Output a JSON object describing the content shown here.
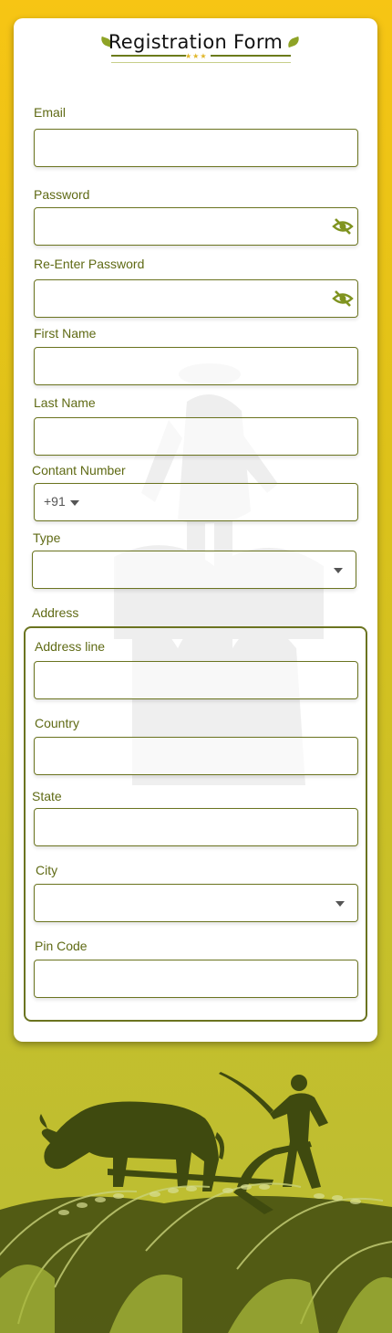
{
  "form": {
    "title": "Registration  Form",
    "email_label": "Email",
    "password_label": "Password",
    "reenter_password_label": "Re-Enter Password",
    "first_name_label": "First Name",
    "last_name_label": "Last Name",
    "contact_label": "Contant Number",
    "country_code": "+91",
    "type_label": "Type",
    "address_label": "Address",
    "address": {
      "address_line_label": "Address line",
      "country_label": "Country",
      "state_label": "State",
      "city_label": "City",
      "pin_label": "Pin Code"
    }
  },
  "colors": {
    "accent": "#6b7420",
    "label": "#5f6a14",
    "bg_top": "#f7c514",
    "bg_bottom": "#b9bd35"
  },
  "icons": {
    "password_toggle": "eye-off-icon",
    "dropdown": "caret-down-icon"
  }
}
